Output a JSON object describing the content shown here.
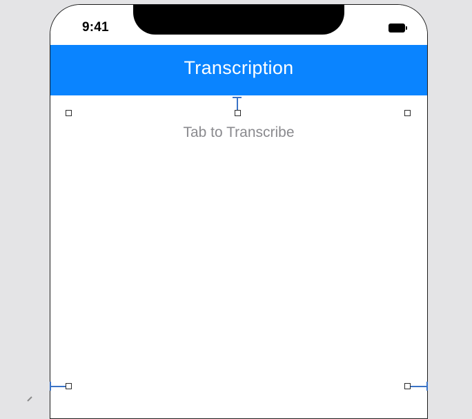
{
  "status_bar": {
    "time": "9:41"
  },
  "nav_bar": {
    "title": "Transcription"
  },
  "content": {
    "label": "Tab to Transcribe"
  },
  "colors": {
    "nav_background": "#0a84ff",
    "canvas_background": "#e4e4e6",
    "label_text": "#8a8a8e",
    "constraint": "#3a73c6"
  },
  "icons": {
    "battery": "battery-icon",
    "resize_handle": "resize-handle-icon"
  }
}
